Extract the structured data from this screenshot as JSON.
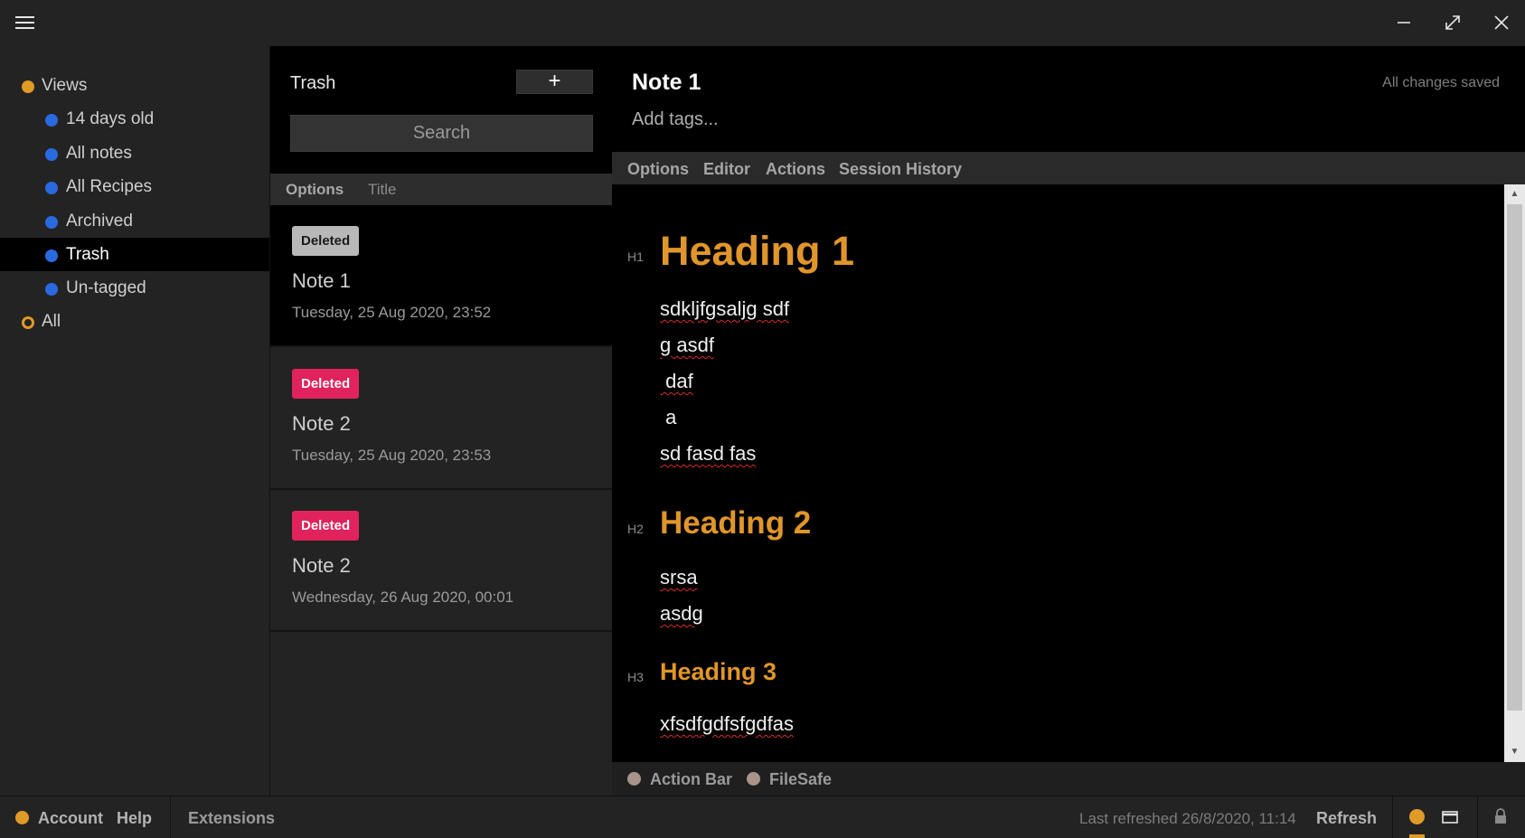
{
  "window": {
    "menu_icon": "hamburger-icon",
    "minimize_icon": "minimize-icon",
    "maximize_icon": "maximize-icon",
    "close_icon": "close-icon"
  },
  "sidebar": {
    "items": [
      {
        "label": "Views",
        "indent": 0,
        "dot": "#e09a27",
        "style": "filled"
      },
      {
        "label": "14 days old",
        "indent": 1,
        "dot": "#2a6ae0",
        "style": "filled"
      },
      {
        "label": "All notes",
        "indent": 1,
        "dot": "#2a6ae0",
        "style": "filled"
      },
      {
        "label": "All Recipes",
        "indent": 1,
        "dot": "#2a6ae0",
        "style": "filled"
      },
      {
        "label": "Archived",
        "indent": 1,
        "dot": "#2a6ae0",
        "style": "filled"
      },
      {
        "label": "Trash",
        "indent": 1,
        "dot": "#2a6ae0",
        "style": "filled",
        "active": true
      },
      {
        "label": "Un-tagged",
        "indent": 1,
        "dot": "#2a6ae0",
        "style": "filled"
      },
      {
        "label": "All",
        "indent": 0,
        "dot": "#e09a27",
        "style": "ring"
      }
    ]
  },
  "notes": {
    "title": "Trash",
    "add_label": "+",
    "search_placeholder": "Search",
    "options_label": "Options",
    "sort_label": "Title",
    "items": [
      {
        "badge": "Deleted",
        "badge_bg": "#b8b8b8",
        "badge_fg": "#1a1a1a",
        "name": "Note 1",
        "date": "Tuesday, 25 Aug 2020, 23:52",
        "active": true
      },
      {
        "badge": "Deleted",
        "badge_bg": "#e0235c",
        "badge_fg": "#ffffff",
        "name": "Note 2",
        "date": "Tuesday, 25 Aug 2020, 23:53"
      },
      {
        "badge": "Deleted",
        "badge_bg": "#e0235c",
        "badge_fg": "#ffffff",
        "name": "Note 2",
        "date": "Wednesday, 26 Aug 2020, 00:01"
      }
    ]
  },
  "editor": {
    "title": "Note 1",
    "tags_placeholder": "Add tags...",
    "save_status": "All changes saved",
    "menu": [
      "Options",
      "Editor",
      "Actions",
      "Session History"
    ],
    "content": {
      "h1_mark": "H1",
      "h1": "Heading 1",
      "block1": [
        "sdkljfgsaljg sdf",
        "g asdf",
        " daf",
        " a",
        "sd fasd fas"
      ],
      "h2_mark": "H2",
      "h2": "Heading 2",
      "block2": [
        "srsa",
        "asdg"
      ],
      "h3_mark": "H3",
      "h3": "Heading 3",
      "block3": [
        "xfsdfgdfsfgdfas"
      ]
    },
    "footer": [
      "Action Bar",
      "FileSafe"
    ]
  },
  "status": {
    "account": "Account",
    "help": "Help",
    "extensions": "Extensions",
    "last_refreshed": "Last refreshed 26/8/2020, 11:14",
    "refresh": "Refresh",
    "status_dot_color": "#e09a27",
    "window_icon": "window-icon",
    "lock_icon": "lock-icon"
  },
  "colors": {
    "accent": "#e09a27",
    "blue_dot": "#2a6ae0",
    "deleted_badge": "#e0235c"
  }
}
